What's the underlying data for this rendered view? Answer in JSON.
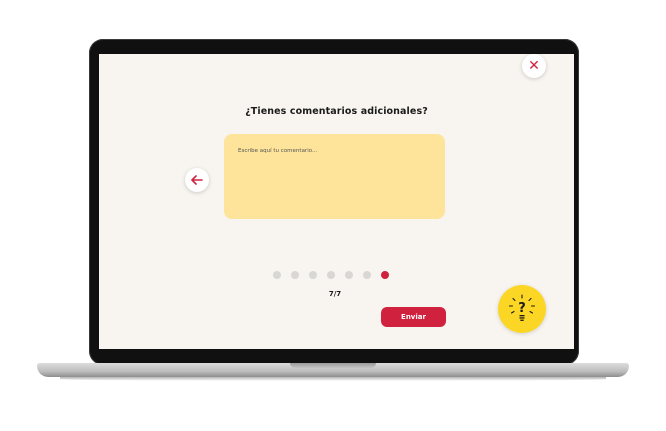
{
  "dialog": {
    "title": "¿Tienes comentarios adicionales?",
    "comment_placeholder": "Escribe aquí tu comentario...",
    "comment_value": ""
  },
  "navigation": {
    "close_icon": "close-icon",
    "back_icon": "arrow-left-icon",
    "counter": "7/7",
    "total_steps": 7,
    "current_step": 7
  },
  "actions": {
    "send_label": "Enviar"
  },
  "help": {
    "icon": "lightbulb-question-icon"
  },
  "colors": {
    "accent": "#d0223f",
    "comment_box": "#fde49a",
    "help_button": "#fcd624",
    "screen_background": "#f8f5f0",
    "dot_inactive": "#d9d7d3"
  }
}
